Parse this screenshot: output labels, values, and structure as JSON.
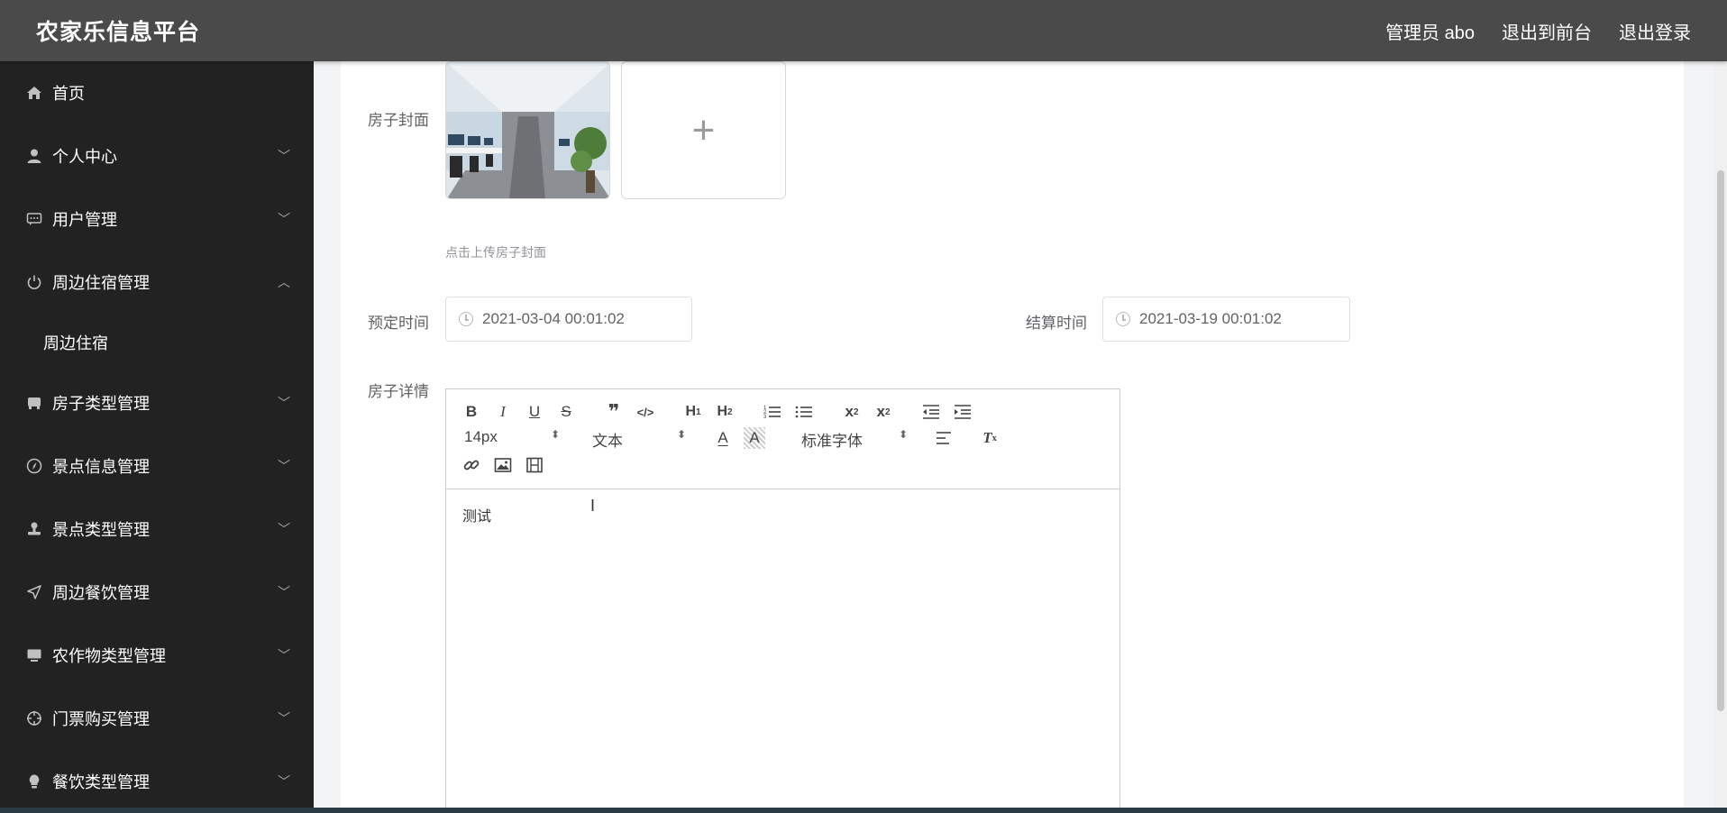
{
  "header": {
    "brand": "农家乐信息平台",
    "admin": "管理员 abo",
    "back_to_front": "退出到前台",
    "logout": "退出登录"
  },
  "sidebar": {
    "items": [
      {
        "label": "首页",
        "icon": "home-icon"
      },
      {
        "label": "个人中心",
        "icon": "user-icon"
      },
      {
        "label": "用户管理",
        "icon": "chat-icon"
      },
      {
        "label": "周边住宿管理",
        "icon": "power-icon"
      },
      {
        "label": "房子类型管理",
        "icon": "bus-icon"
      },
      {
        "label": "景点信息管理",
        "icon": "compass-icon"
      },
      {
        "label": "景点类型管理",
        "icon": "stamp-icon"
      },
      {
        "label": "周边餐饮管理",
        "icon": "send-icon"
      },
      {
        "label": "农作物类型管理",
        "icon": "monitor-icon"
      },
      {
        "label": "门票购买管理",
        "icon": "target-icon"
      },
      {
        "label": "餐饮类型管理",
        "icon": "bulb-icon"
      }
    ],
    "submenu": {
      "label": "周边住宿"
    }
  },
  "form": {
    "cover_label": "房子封面",
    "cover_hint": "点击上传房子封面",
    "book_label": "预定时间",
    "book_value": "2021-03-04 00:01:02",
    "settle_label": "结算时间",
    "settle_value": "2021-03-19 00:01:02",
    "detail_label": "房子详情"
  },
  "editor": {
    "font_size": "14px",
    "header_select": "文本",
    "font_family": "标准字体",
    "content": "测试"
  },
  "colors": {
    "header_bg": "#4a4a4a",
    "sidebar_bg": "#222222"
  }
}
